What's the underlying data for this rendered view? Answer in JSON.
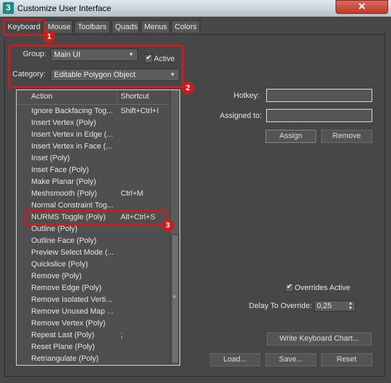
{
  "window": {
    "title": "Customize User Interface",
    "app_icon_text": "3",
    "close_label": "✕"
  },
  "tabs": [
    {
      "label": "Keyboard",
      "active": true
    },
    {
      "label": "Mouse"
    },
    {
      "label": "Toolbars"
    },
    {
      "label": "Quads"
    },
    {
      "label": "Menus"
    },
    {
      "label": "Colors"
    }
  ],
  "group": {
    "label": "Group:",
    "value": "Main UI"
  },
  "active_checkbox": {
    "label": "Active",
    "checked": true
  },
  "category": {
    "label": "Category:",
    "value": "Editable Polygon Object"
  },
  "list": {
    "headers": {
      "action": "Action",
      "shortcut": "Shortcut"
    },
    "rows": [
      {
        "action": "Ignore Backfacing Tog...",
        "shortcut": "Shift+Ctrl+I"
      },
      {
        "action": "Insert Vertex (Poly)",
        "shortcut": ""
      },
      {
        "action": "Insert Vertex in Edge (...",
        "shortcut": ""
      },
      {
        "action": "Insert Vertex in Face (...",
        "shortcut": ""
      },
      {
        "action": "Inset (Poly)",
        "shortcut": ""
      },
      {
        "action": "Inset Face (Poly)",
        "shortcut": ""
      },
      {
        "action": "Make Planar (Poly)",
        "shortcut": ""
      },
      {
        "action": "Meshsmooth (Poly)",
        "shortcut": "Ctrl+M"
      },
      {
        "action": "Normal Constraint Tog...",
        "shortcut": ""
      },
      {
        "action": "NURMS Toggle (Poly)",
        "shortcut": "Alt+Ctrl+S",
        "highlight": true
      },
      {
        "action": "Outline (Poly)",
        "shortcut": ""
      },
      {
        "action": "Outline Face (Poly)",
        "shortcut": ""
      },
      {
        "action": "Preview Select Mode (...",
        "shortcut": ""
      },
      {
        "action": "Quickslice (Poly)",
        "shortcut": ""
      },
      {
        "action": "Remove (Poly)",
        "shortcut": ""
      },
      {
        "action": "Remove Edge (Poly)",
        "shortcut": ""
      },
      {
        "action": "Remove Isolated Verti...",
        "shortcut": ""
      },
      {
        "action": "Remove Unused Map ...",
        "shortcut": ""
      },
      {
        "action": "Remove Vertex (Poly)",
        "shortcut": ""
      },
      {
        "action": "Repeat Last (Poly)",
        "shortcut": ";"
      },
      {
        "action": "Reset Plane (Poly)",
        "shortcut": ""
      },
      {
        "action": "Retriangulate (Poly)",
        "shortcut": ""
      }
    ]
  },
  "hotkey": {
    "label": "Hotkey:",
    "value": ""
  },
  "assigned_to": {
    "label": "Assigned to:",
    "value": ""
  },
  "buttons": {
    "assign": "Assign",
    "remove": "Remove",
    "write_chart": "Write Keyboard Chart...",
    "load": "Load...",
    "save": "Save...",
    "reset": "Reset"
  },
  "overrides": {
    "label": "Overrides Active",
    "checked": true
  },
  "delay": {
    "label": "Delay To Override:",
    "value": "0,25"
  },
  "annotations": {
    "badge1": "1",
    "badge2": "2",
    "badge3": "3"
  },
  "colors": {
    "annotation_red": "#c51f1f",
    "panel_bg": "#474747"
  }
}
